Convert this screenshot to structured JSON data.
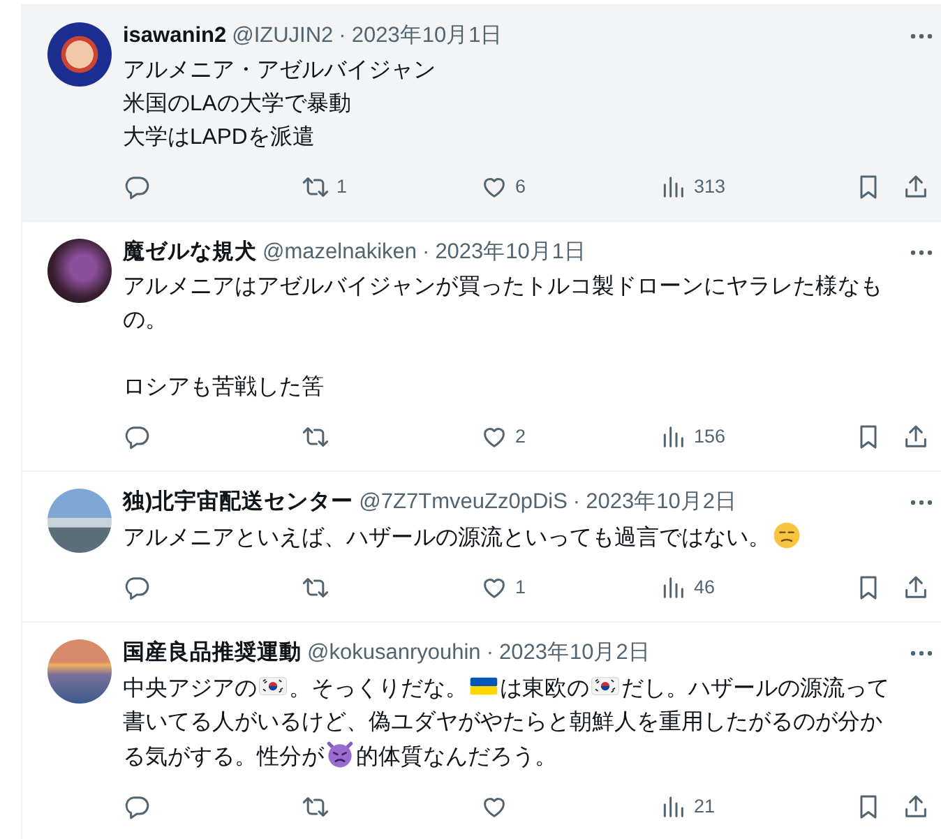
{
  "tweets": [
    {
      "name": "isawanin2",
      "handle": "@IZUJIN2",
      "separator": "·",
      "date": "2023年10月1日",
      "hovered": true,
      "body": [
        {
          "kind": "line",
          "text": "アルメニア・アゼルバイジャン"
        },
        {
          "kind": "line",
          "text": "米国のLAの大学で暴動"
        },
        {
          "kind": "line",
          "text": "大学はLAPDを派遣"
        }
      ],
      "actions": [
        {
          "kind": "reply"
        },
        {
          "kind": "repost",
          "count": "1"
        },
        {
          "kind": "like",
          "count": "6"
        },
        {
          "kind": "views",
          "count": "313"
        },
        {
          "kind": "bookmark"
        },
        {
          "kind": "share"
        }
      ]
    },
    {
      "name": "魔ゼルな規犬",
      "handle": "@mazelnakiken",
      "separator": "·",
      "date": "2023年10月1日",
      "hovered": false,
      "body": [
        {
          "kind": "line",
          "text": "アルメニアはアゼルバイジャンが買ったトルコ製ドローンにヤラレた様なも"
        },
        {
          "kind": "line",
          "text": "の。"
        },
        {
          "kind": "paragraph",
          "text": "ロシアも苦戦した筈"
        }
      ],
      "actions": [
        {
          "kind": "reply"
        },
        {
          "kind": "repost"
        },
        {
          "kind": "like",
          "count": "2"
        },
        {
          "kind": "views",
          "count": "156"
        },
        {
          "kind": "bookmark"
        },
        {
          "kind": "share"
        }
      ]
    },
    {
      "name": "独)北宇宙配送センター",
      "handle": "@7Z7TmveuZz0pDiS",
      "separator": "·",
      "date": "2023年10月2日",
      "hovered": false,
      "body": [
        {
          "kind": "text",
          "text": "アルメニアといえば、ハザールの源流といっても過言ではない。"
        },
        {
          "kind": "unamused_face"
        }
      ],
      "actions": [
        {
          "kind": "reply"
        },
        {
          "kind": "repost"
        },
        {
          "kind": "like",
          "count": "1"
        },
        {
          "kind": "views",
          "count": "46"
        },
        {
          "kind": "bookmark"
        },
        {
          "kind": "share"
        }
      ]
    },
    {
      "name": "国産良品推奨運動",
      "handle": "@kokusanryouhin",
      "separator": "·",
      "date": "2023年10月2日",
      "hovered": false,
      "body": [
        {
          "kind": "text",
          "text": "中央アジアの"
        },
        {
          "kind": "korea_flag"
        },
        {
          "kind": "text",
          "text": "。そっくりだな。"
        },
        {
          "kind": "ukraine_flag"
        },
        {
          "kind": "text",
          "text": "は東欧の"
        },
        {
          "kind": "korea_flag"
        },
        {
          "kind": "text",
          "text": "だし。ハザールの源流って"
        },
        {
          "kind": "text",
          "text": "書いてる人がいるけど、偽ユダヤがやたらと朝鮮人を重用したがるのが分か"
        },
        {
          "kind": "text",
          "text": "る気がする。性分が"
        },
        {
          "kind": "devil_face"
        },
        {
          "kind": "text",
          "text": "的体質なんだろう。"
        }
      ],
      "actions": [
        {
          "kind": "reply"
        },
        {
          "kind": "repost"
        },
        {
          "kind": "like"
        },
        {
          "kind": "views",
          "count": "21"
        },
        {
          "kind": "bookmark"
        },
        {
          "kind": "share"
        }
      ]
    }
  ]
}
